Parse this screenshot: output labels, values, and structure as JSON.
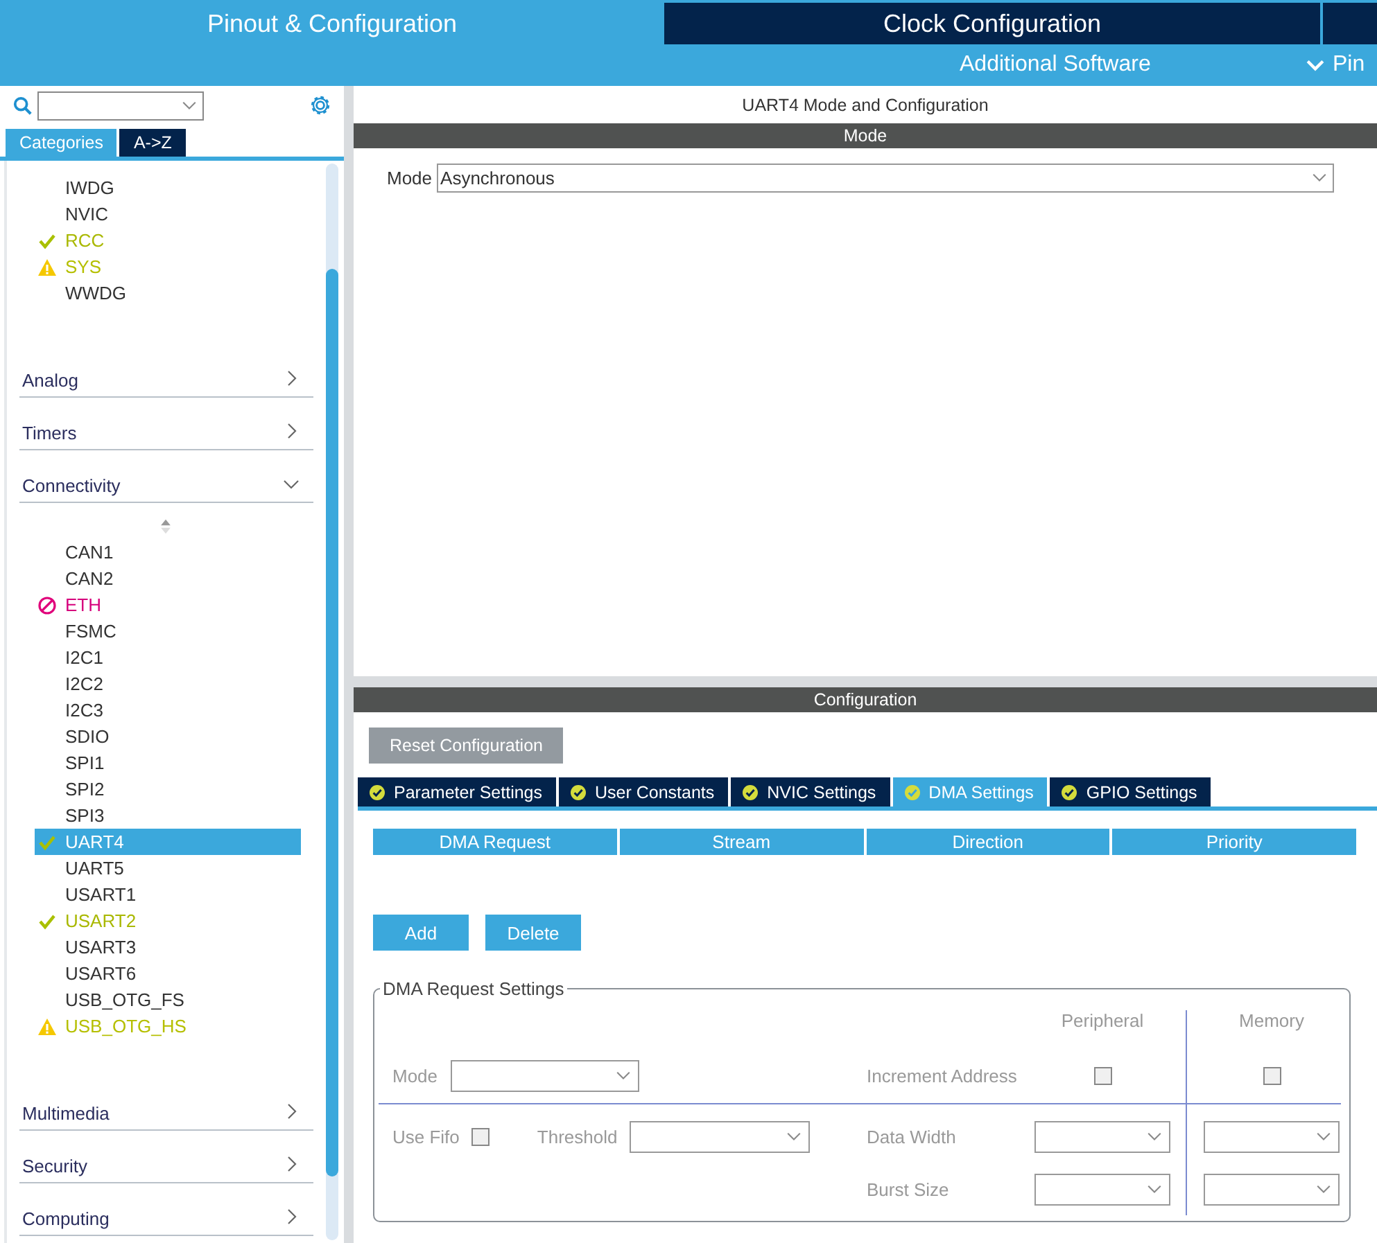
{
  "top_tabs": [
    {
      "label": "Pinout & Configuration",
      "selected": true
    },
    {
      "label": "Clock Configuration",
      "selected": false
    }
  ],
  "sub_bar": {
    "link": "Additional Software",
    "menu": "Pin"
  },
  "sidebar": {
    "tabs": [
      {
        "label": "Categories",
        "selected": true
      },
      {
        "label": "A->Z",
        "selected": false
      }
    ],
    "top_items": [
      {
        "label": "IWDG",
        "kind": "plain",
        "selected": false
      },
      {
        "label": "NVIC",
        "kind": "plain",
        "selected": false
      },
      {
        "label": "RCC",
        "kind": "ok",
        "selected": false
      },
      {
        "label": "SYS",
        "kind": "warning",
        "selected": false
      },
      {
        "label": "WWDG",
        "kind": "plain",
        "selected": false
      }
    ],
    "categories": [
      {
        "label": "Analog",
        "expanded": false
      },
      {
        "label": "Timers",
        "expanded": false
      },
      {
        "label": "Connectivity",
        "expanded": true,
        "children": [
          {
            "label": "CAN1",
            "kind": "plain",
            "selected": false
          },
          {
            "label": "CAN2",
            "kind": "plain",
            "selected": false
          },
          {
            "label": "ETH",
            "kind": "error",
            "selected": false
          },
          {
            "label": "FSMC",
            "kind": "plain",
            "selected": false
          },
          {
            "label": "I2C1",
            "kind": "plain",
            "selected": false
          },
          {
            "label": "I2C2",
            "kind": "plain",
            "selected": false
          },
          {
            "label": "I2C3",
            "kind": "plain",
            "selected": false
          },
          {
            "label": "SDIO",
            "kind": "plain",
            "selected": false
          },
          {
            "label": "SPI1",
            "kind": "plain",
            "selected": false
          },
          {
            "label": "SPI2",
            "kind": "plain",
            "selected": false
          },
          {
            "label": "SPI3",
            "kind": "plain",
            "selected": false
          },
          {
            "label": "UART4",
            "kind": "ok",
            "selected": true
          },
          {
            "label": "UART5",
            "kind": "plain",
            "selected": false
          },
          {
            "label": "USART1",
            "kind": "plain",
            "selected": false
          },
          {
            "label": "USART2",
            "kind": "ok",
            "selected": false
          },
          {
            "label": "USART3",
            "kind": "plain",
            "selected": false
          },
          {
            "label": "USART6",
            "kind": "plain",
            "selected": false
          },
          {
            "label": "USB_OTG_FS",
            "kind": "plain",
            "selected": false
          },
          {
            "label": "USB_OTG_HS",
            "kind": "warning",
            "selected": false
          }
        ]
      },
      {
        "label": "Multimedia",
        "expanded": false
      },
      {
        "label": "Security",
        "expanded": false
      },
      {
        "label": "Computing",
        "expanded": false
      }
    ]
  },
  "main": {
    "title": "UART4 Mode and Configuration",
    "mode_header": "Mode",
    "mode": {
      "label": "Mode",
      "value": "Asynchronous"
    },
    "config_header": "Configuration",
    "reset_button": "Reset Configuration",
    "tabs": [
      {
        "label": "Parameter Settings",
        "selected": false
      },
      {
        "label": "User Constants",
        "selected": false
      },
      {
        "label": "NVIC Settings",
        "selected": false
      },
      {
        "label": "DMA Settings",
        "selected": true
      },
      {
        "label": "GPIO Settings",
        "selected": false
      }
    ],
    "table": {
      "columns": [
        "DMA Request",
        "Stream",
        "Direction",
        "Priority"
      ]
    },
    "buttons": [
      "Add",
      "Delete"
    ],
    "dma_settings": {
      "legend": "DMA Request Settings",
      "peripheral_heading": "Peripheral",
      "memory_heading": "Memory",
      "mode_label": "Mode",
      "increment_label": "Increment Address",
      "peripheral_increment": {
        "checked": false
      },
      "memory_increment": {
        "checked": false
      },
      "use_fifo": {
        "label": "Use Fifo",
        "checked": false
      },
      "threshold_label": "Threshold",
      "data_width_label": "Data Width",
      "burst_size_label": "Burst Size"
    }
  }
}
